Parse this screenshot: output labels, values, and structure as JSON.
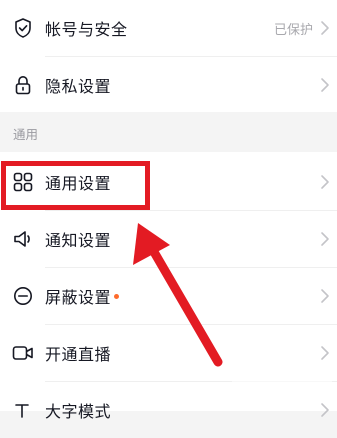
{
  "account_security": {
    "label": "帐号与安全",
    "value": "已保护",
    "icon": "shield-check-icon"
  },
  "privacy": {
    "label": "隐私设置",
    "icon": "lock-icon"
  },
  "section_general": {
    "title": "通用"
  },
  "general_settings": {
    "label": "通用设置",
    "icon": "grid-icon"
  },
  "notification_settings": {
    "label": "通知设置",
    "icon": "speaker-icon"
  },
  "block_settings": {
    "label": "屏蔽设置",
    "icon": "minus-circle-icon",
    "badge_color": "#fe6b2c"
  },
  "start_live": {
    "label": "开通直播",
    "icon": "video-camera-icon"
  },
  "large_font": {
    "label": "大字模式",
    "icon": "text-size-icon"
  },
  "annotation": {
    "box_color": "#e31b23",
    "arrow_color": "#e31b23"
  }
}
